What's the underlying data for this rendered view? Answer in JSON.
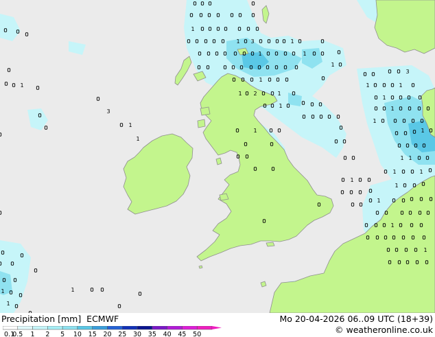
{
  "map": {
    "colors": {
      "sea": "#ebebeb",
      "land": "#c3f58d",
      "coast": "#8f8f8f",
      "precip_light": "#c6f5f9",
      "precip_mid": "#8fe2f0",
      "precip_high": "#5ac8e6"
    },
    "point_values": [
      "0",
      "0",
      "0",
      "0",
      "0",
      "0",
      "0",
      "0",
      "1",
      "0",
      "0",
      "1",
      "0",
      "0",
      "0",
      "0",
      "0",
      "0",
      "0",
      "0",
      "0",
      "0",
      "0",
      "1",
      "1",
      "2",
      "3",
      "1",
      "1",
      "1",
      "1",
      "1",
      "2",
      "2",
      "1",
      "0",
      "0",
      "0",
      "0",
      "1",
      "1",
      "1",
      "1",
      "1",
      "1",
      "0",
      "1",
      "0",
      "0",
      "0",
      "0",
      "0",
      "0",
      "1",
      "0",
      "1",
      "0",
      "0",
      "0",
      "0",
      "1",
      "1",
      "1",
      "1",
      "0",
      "1",
      "1",
      "1",
      "0",
      "1",
      "1",
      "1",
      "1",
      "2",
      "3",
      "1",
      "1",
      "0",
      "1",
      "1",
      "1",
      "0",
      "0",
      "0",
      "0",
      "0",
      "0",
      "0",
      "0",
      "1",
      "0",
      "1",
      "1",
      "1",
      "0"
    ]
  },
  "legend": {
    "title": "Precipitation [mm]",
    "model": "ECMWF",
    "ticks": [
      "0.1",
      "0.5",
      "1",
      "2",
      "5",
      "10",
      "15",
      "20",
      "25",
      "30",
      "35",
      "40",
      "45",
      "50"
    ],
    "colors": [
      "#ffffff",
      "#e0f9fb",
      "#c6f5f9",
      "#a6eef5",
      "#8fe2f0",
      "#5ac8e6",
      "#3a9fdc",
      "#2562d6",
      "#1231b8",
      "#0a1490",
      "#7a18c8",
      "#b21ad8",
      "#de1ed8",
      "#f01ec0"
    ]
  },
  "valid_time": "Mo 20-04-2026 06..09 UTC (18+39)",
  "credit": "© weatheronline.co.uk"
}
